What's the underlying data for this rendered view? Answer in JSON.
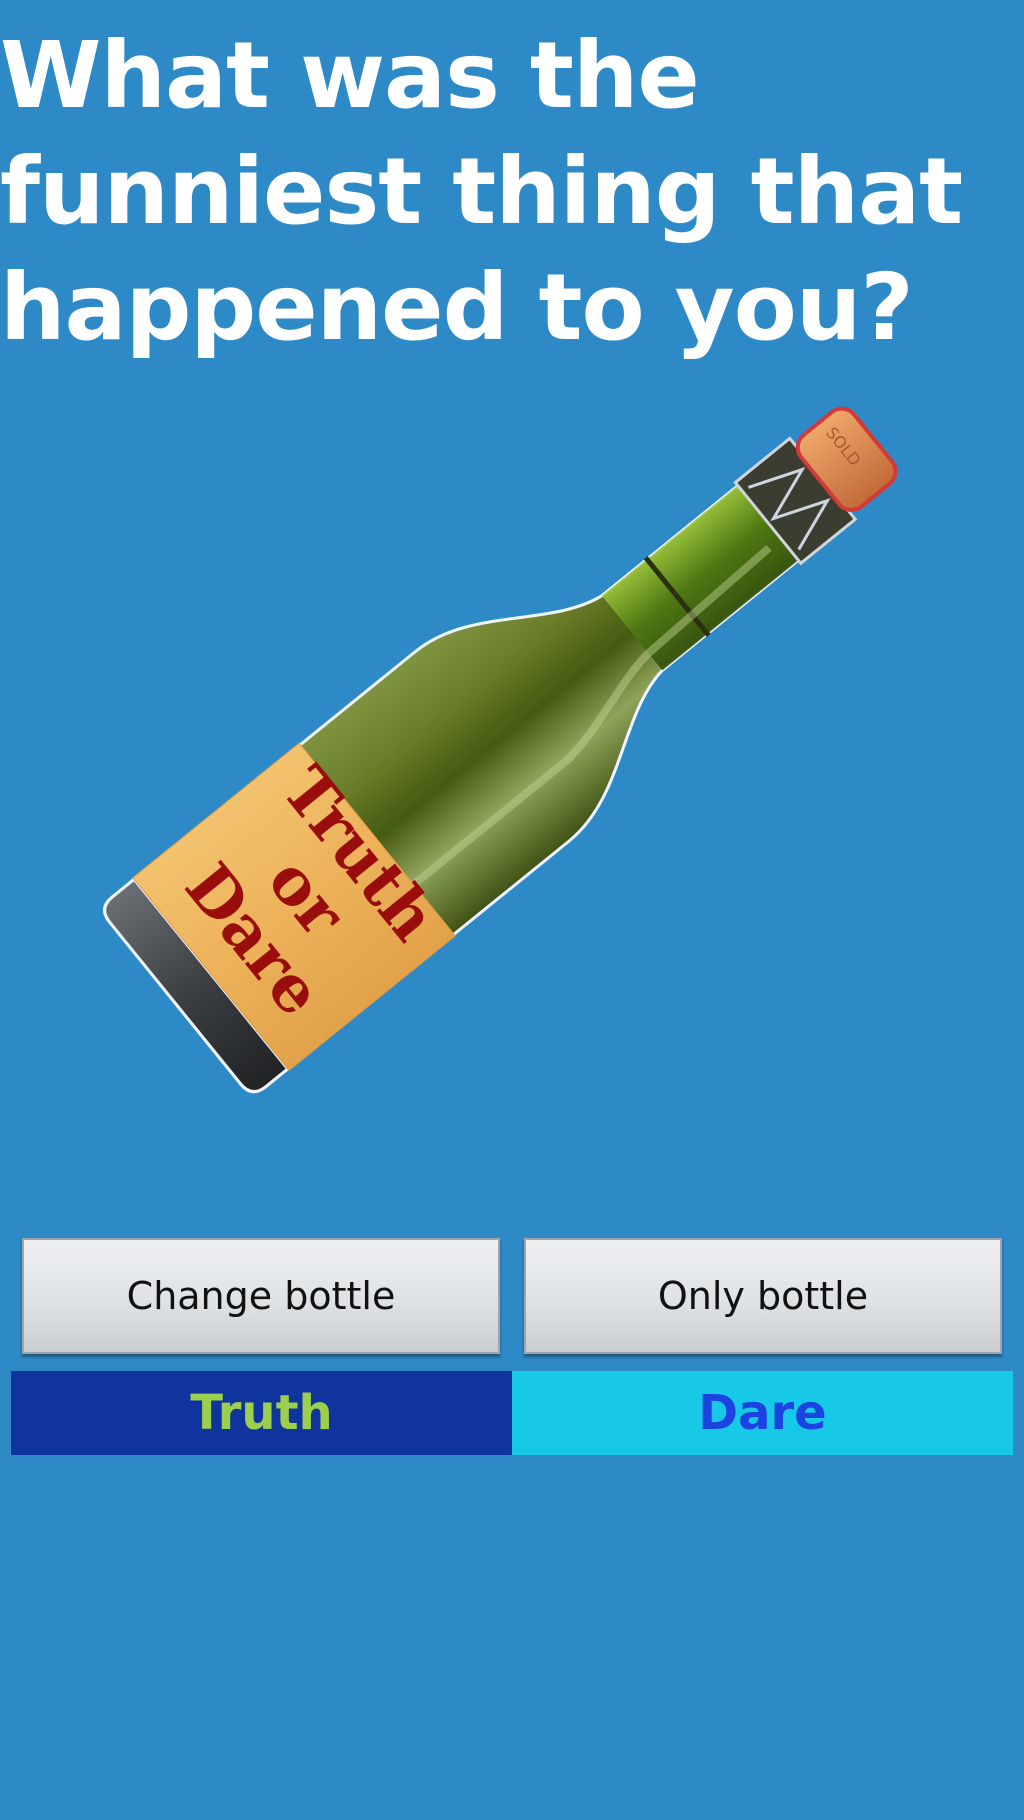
{
  "question": {
    "text": "What was the funniest thing that happened to you?"
  },
  "bottle": {
    "label_lines": [
      "Truth",
      "or",
      "Dare"
    ],
    "cork_text": "SOLD",
    "label_color": "#efb45a",
    "label_text_color": "#9a0d0d",
    "glass_color": "#5f7a22"
  },
  "controls": {
    "change_bottle_label": "Change bottle",
    "only_bottle_label": "Only bottle"
  },
  "mode_buttons": {
    "truth_label": "Truth",
    "dare_label": "Dare",
    "truth_bg": "#10349e",
    "truth_fg": "#9ccf4e",
    "dare_bg": "#17c9e6",
    "dare_fg": "#1c43e0"
  },
  "colors": {
    "background": "#2e8ac6"
  }
}
